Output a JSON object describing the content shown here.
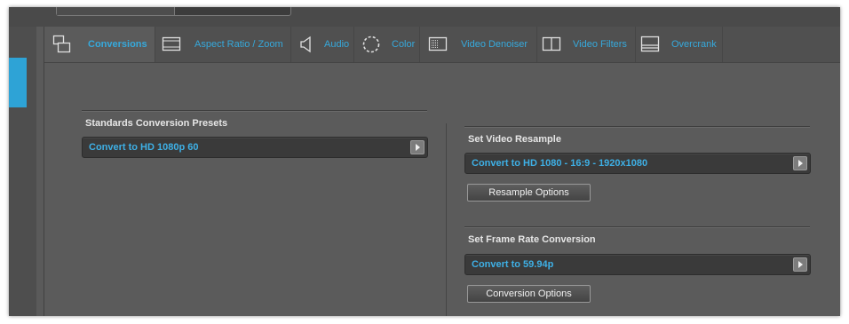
{
  "tabs": [
    {
      "label": "Conversions",
      "icon": "conversions-icon"
    },
    {
      "label": "Aspect Ratio / Zoom",
      "icon": "aspect-ratio-icon"
    },
    {
      "label": "Audio",
      "icon": "audio-icon"
    },
    {
      "label": "Color",
      "icon": "color-icon"
    },
    {
      "label": "Video Denoiser",
      "icon": "video-denoiser-icon"
    },
    {
      "label": "Video Filters",
      "icon": "video-filters-icon"
    },
    {
      "label": "Overcrank",
      "icon": "overcrank-icon"
    }
  ],
  "standards": {
    "title": "Standards Conversion Presets",
    "value": "Convert to HD 1080p 60"
  },
  "resample": {
    "title": "Set Video Resample",
    "value": "Convert to HD 1080 - 16:9 - 1920x1080",
    "button": "Resample Options"
  },
  "framerate": {
    "title": "Set Frame Rate Conversion",
    "value": "Convert to 59.94p",
    "button": "Conversion Options"
  },
  "colors": {
    "accent": "#36a9dc",
    "panel": "#5b5b5b",
    "dropdown": "#3a3a3a",
    "left_tab": "#2ea3d6"
  }
}
